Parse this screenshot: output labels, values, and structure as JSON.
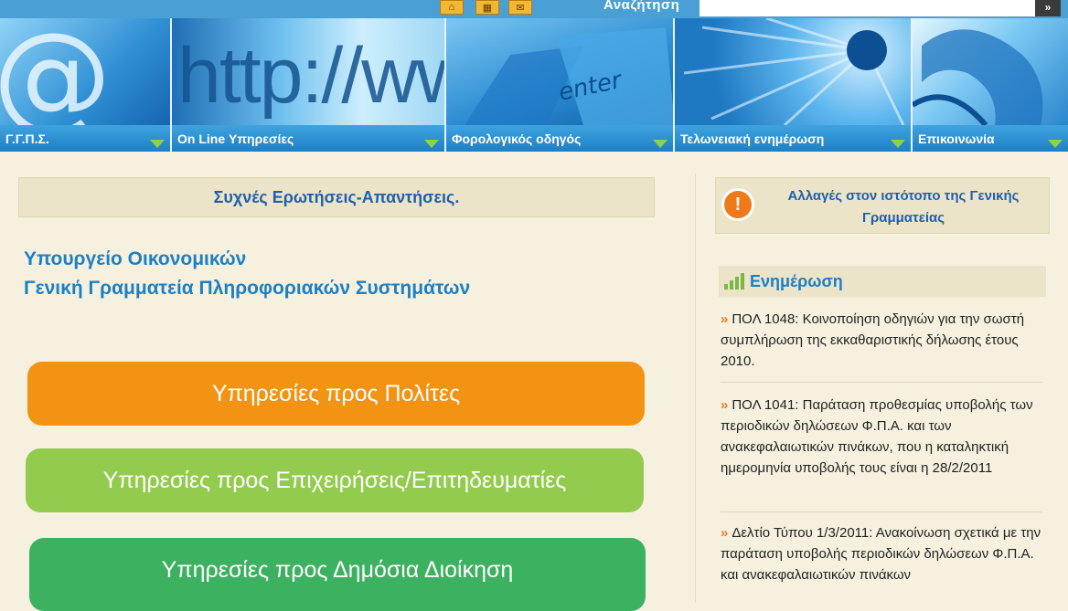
{
  "topbar": {
    "icons": [
      "home-icon",
      "sitemap-icon",
      "mail-icon"
    ],
    "search_label": "Αναζήτηση",
    "search_value": "",
    "search_button": "»"
  },
  "nav": {
    "items": [
      {
        "label": "Γ.Γ.Π.Σ."
      },
      {
        "label": "On Line Υπηρεσίες"
      },
      {
        "label": "Φορολογικός οδηγός"
      },
      {
        "label": "Τελωνειακή ενημέρωση"
      },
      {
        "label": "Επικοινωνία"
      }
    ],
    "banner_text": "http://www",
    "key_text": "enter"
  },
  "main": {
    "faq": "Συχνές Ερωτήσεις-Απαντήσεις.",
    "ministry_line1": "Υπουργείο Οικονομικών",
    "ministry_line2": "Γενική Γραμματεία Πληροφοριακών Συστημάτων",
    "buttons": [
      {
        "label": "Υπηρεσίες προς Πολίτες",
        "color": "#f39313"
      },
      {
        "label": "Υπηρεσίες προς Επιχειρήσεις/Επιτηδευματίες",
        "color": "#93cb4e"
      },
      {
        "label": "Υπηρεσίες προς Δημόσια Διοίκηση",
        "color": "#3cb160"
      }
    ]
  },
  "sidebar": {
    "notice_icon": "!",
    "notice": "Αλλαγές στον ιστότοπο της Γενικής Γραμματείας",
    "news_title": "Ενημέρωση",
    "news": [
      {
        "text": "ΠΟΛ 1048: Κοινοποίηση οδηγιών για την σωστή συμπλήρωση της εκκαθαριστικής δήλωσης έτους 2010."
      },
      {
        "text": "ΠΟΛ 1041: Παράταση προθεσμίας υποβολής των περιοδικών δηλώσεων Φ.Π.Α. και των ανακεφαλαιωτικών πινάκων, που η καταληκτική ημερομηνία υποβολής τους είναι η 28/2/2011"
      },
      {
        "text": "Δελτίο Τύπου 1/3/2011: Ανακοίνωση σχετικά με την παράταση υποβολής περιοδικών δηλώσεων Φ.Π.Α. και ανακεφαλαιωτικών πινάκων"
      }
    ]
  },
  "colors": {
    "accent_blue": "#1d7fc4",
    "nav_bar": "#2a8fd3",
    "page_bg": "#f6f1df",
    "orange": "#f39313",
    "light_green": "#93cb4e",
    "green": "#3cb160"
  }
}
